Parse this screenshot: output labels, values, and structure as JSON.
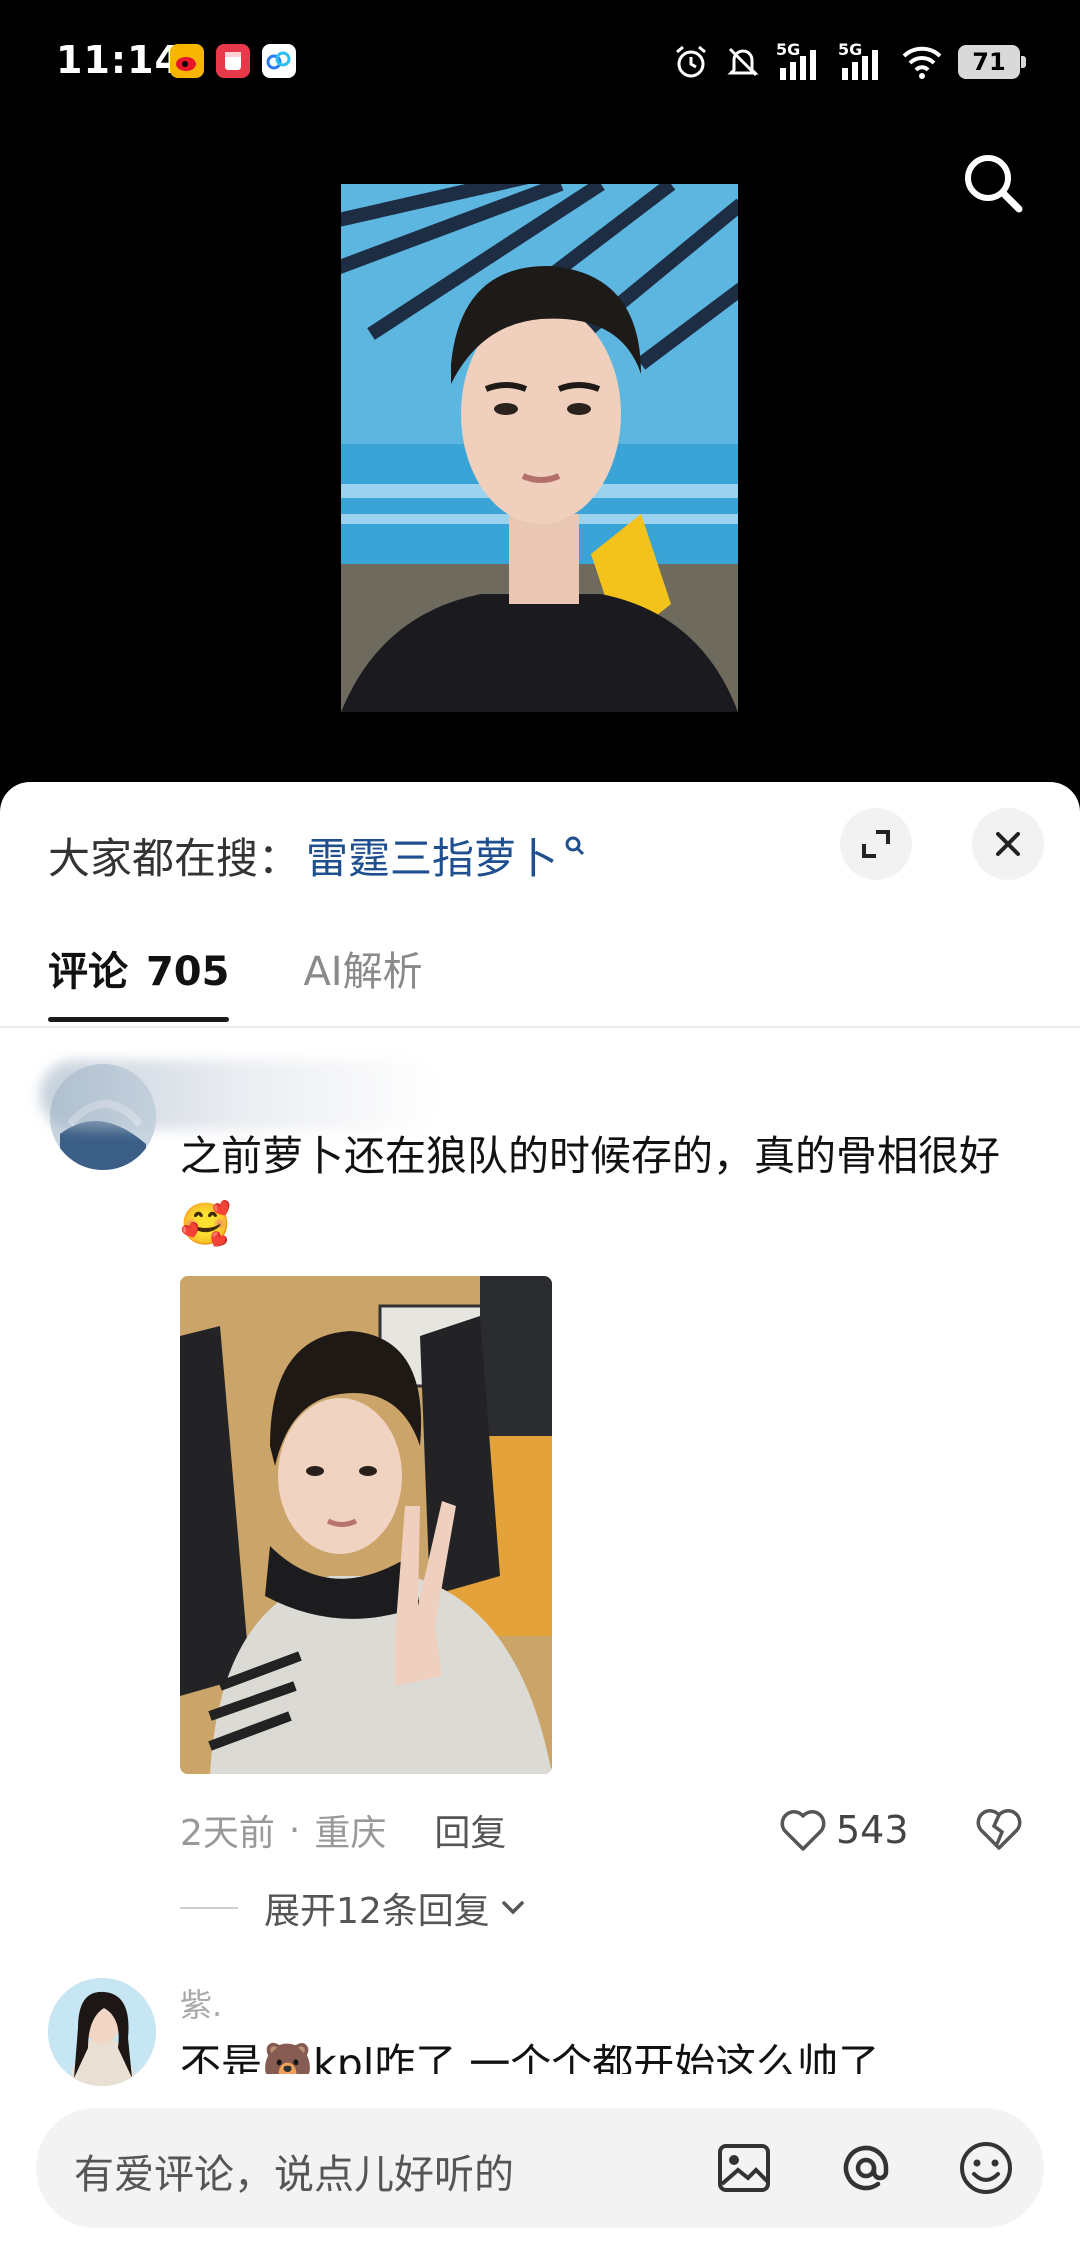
{
  "status_bar": {
    "time": "11:14",
    "signal_1": "5G",
    "signal_2": "5G",
    "battery": "71"
  },
  "sheet": {
    "hot_search_prefix": "大家都在搜：",
    "hot_search_term": "雷霆三指萝卜",
    "tabs": [
      {
        "label": "评论",
        "count": "705"
      },
      {
        "label": "AI解析"
      }
    ]
  },
  "comments": [
    {
      "text": "之前萝卜还在狼队的时候存的，真的骨相很好🥰",
      "time": "2天前",
      "location": "重庆",
      "reply_label": "回复",
      "likes": "543",
      "expand_label": "展开12条回复"
    },
    {
      "username": "紫.",
      "text": "不是🐻kpl咋了 一个个都开始这么帅了"
    }
  ],
  "input": {
    "placeholder": "有爱评论，说点儿好听的"
  },
  "icons": [
    "search-icon",
    "expand-icon",
    "close-icon",
    "heart-icon",
    "broken-heart-icon",
    "chevron-down-icon",
    "image-icon",
    "at-icon",
    "emoji-icon",
    "alarm-icon",
    "mute-icon",
    "wifi-icon"
  ]
}
